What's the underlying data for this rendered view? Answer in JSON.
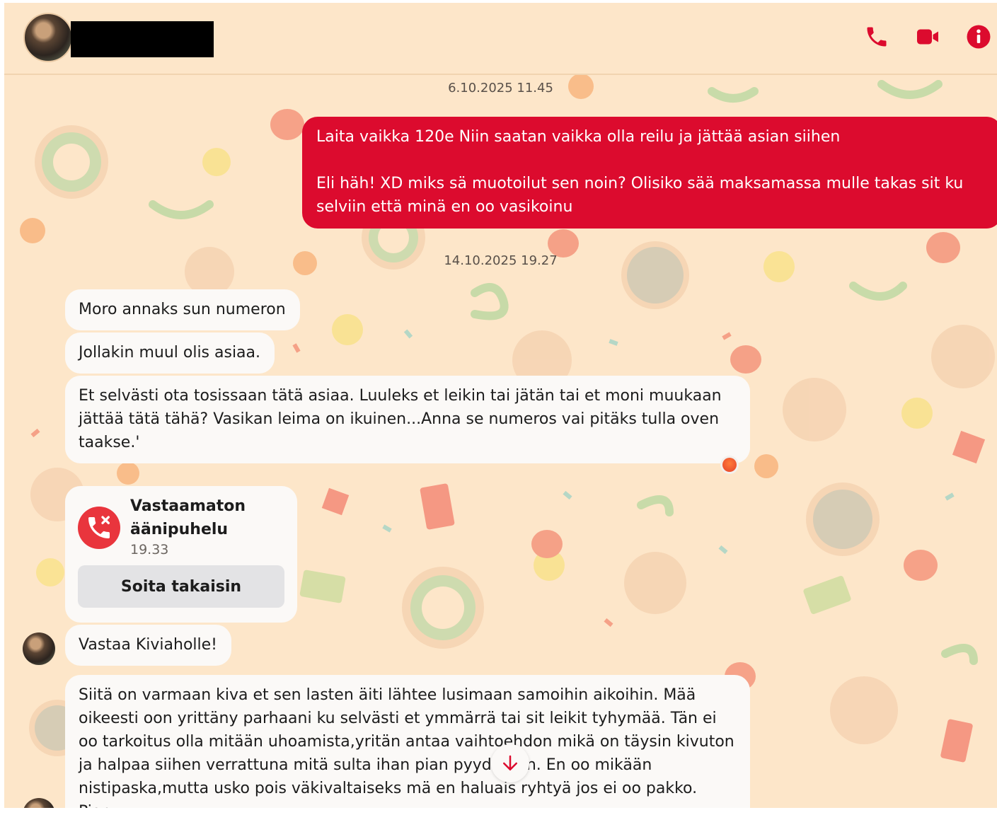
{
  "header": {
    "call_icon": "phone-icon",
    "video_icon": "video-camera-icon",
    "info_icon": "info-icon",
    "accent": "#dc0b2e"
  },
  "timestamps": [
    "6.10.2025 11.45",
    "14.10.2025 19.27"
  ],
  "outgoing": {
    "text": "Laita vaikka 120e Niin saatan vaikka olla reilu ja jättää asian siihen\n\nEli häh! XD miks sä muotoilut sen noin? Olisiko sää maksamassa mulle takas sit ku selviin että minä en oo vasikoinu",
    "color": "#dc0b2e"
  },
  "incoming": [
    "Moro annaks sun numeron",
    "Jollakin muul olis asiaa.",
    "Et selvästi ota tosissaan tätä asiaa. Luuleks et leikin tai jätän tai et moni muukaan jättää tätä tähä? Vasikan leima on ikuinen...Anna se numeros vai pitäks tulla oven taakse.'",
    "Vastaa Kiviaholle!",
    "Siitä on varmaan kiva et sen lasten äiti lähtee lusimaan samoihin aikoihin. Mää oikeesti oon yrittäny parhaani ku selvästi et ymmärrä tai sit leikit tyhymää. Tän ei oo tarkoitus olla mitään uhoamista,yritän antaa vaihtoehdon mikä on täysin kivuton ja halpaa siihen verrattuna mitä sulta ihan pian pyydetään. En oo mikään nistipaska,mutta usko pois väkivaltaiseks mä en haluais ryhtyä jos ei oo pakko. Pian..."
  ],
  "reaction": "angry-face-emoji",
  "missed_call": {
    "title": "Vastaamaton\näänipuhelu",
    "time": "19.33",
    "button": "Soita takaisin",
    "icon": "missed-call-icon"
  },
  "scroll_icon": "arrow-down-icon"
}
